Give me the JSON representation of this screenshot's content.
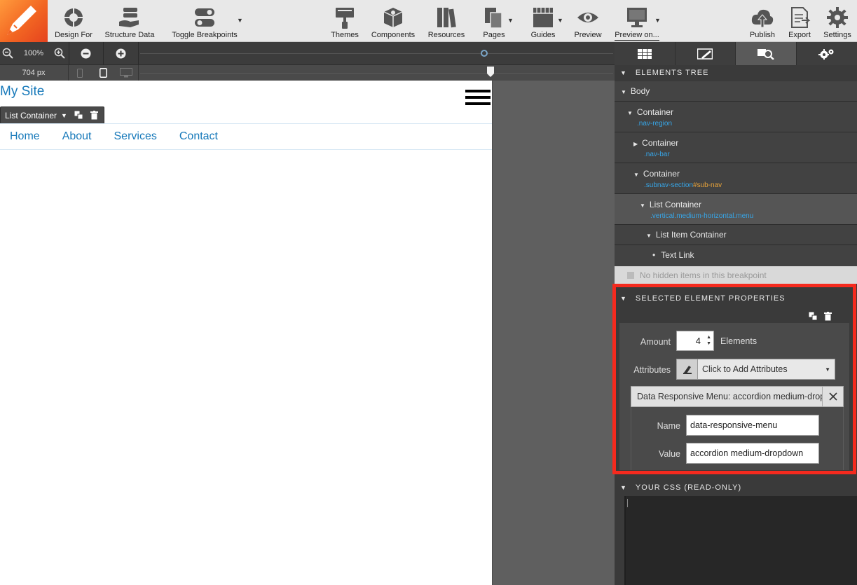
{
  "toolbar": {
    "tools_left": [
      {
        "label": "Design For",
        "icon": "target-icon"
      },
      {
        "label": "Structure Data",
        "icon": "stack-hand-icon"
      },
      {
        "label": "Toggle Breakpoints",
        "icon": "toggle-icon"
      }
    ],
    "tools_mid": [
      {
        "label": "Themes",
        "icon": "paint-roller-icon"
      },
      {
        "label": "Components",
        "icon": "cubes-icon"
      },
      {
        "label": "Resources",
        "icon": "books-icon"
      },
      {
        "label": "Pages",
        "icon": "pages-icon"
      },
      {
        "label": "Guides",
        "icon": "guides-icon"
      },
      {
        "label": "Preview",
        "icon": "eye-icon"
      },
      {
        "label": "Preview on...",
        "icon": "monitor-icon"
      }
    ],
    "tools_right": [
      {
        "label": "Publish",
        "icon": "cloud-upload-icon"
      },
      {
        "label": "Export",
        "icon": "export-icon"
      },
      {
        "label": "Settings",
        "icon": "gear-icon"
      }
    ]
  },
  "zoom": {
    "level": "100%",
    "slider_value": 0.727
  },
  "viewport": {
    "width_label": "704 px",
    "slider_value": 0.74
  },
  "canvas": {
    "site_title": "My Site",
    "selected_chip": "List Container",
    "nav_links": [
      "Home",
      "About",
      "Services",
      "Contact"
    ]
  },
  "elements_tree": {
    "header": "ELEMENTS TREE",
    "body_label": "Body",
    "rows": [
      {
        "name": "Container",
        "cls": ".nav-region",
        "id": ""
      },
      {
        "name": "Container",
        "cls": ".nav-bar",
        "id": ""
      },
      {
        "name": "Container",
        "cls": ".subnav-section",
        "id": "#sub-nav"
      },
      {
        "name": "List Container",
        "cls": ".vertical.medium-horizontal.menu",
        "id": ""
      },
      {
        "name": "List Item Container",
        "cls": "",
        "id": ""
      },
      {
        "name": "Text Link",
        "cls": "",
        "id": ""
      }
    ],
    "hidden_note": "No hidden items in this breakpoint"
  },
  "properties": {
    "header": "SELECTED ELEMENT PROPERTIES",
    "amount_label": "Amount",
    "amount_value": "4",
    "amount_unit": "Elements",
    "attributes_label": "Attributes",
    "attributes_placeholder": "Click to Add Attributes",
    "attribute_title": "Data Responsive Menu: accordion medium-dropdown",
    "name_label": "Name",
    "name_value": "data-responsive-menu",
    "value_label": "Value",
    "value_value": "accordion medium-dropdown"
  },
  "css": {
    "header": "YOUR CSS (READ-ONLY)"
  },
  "colors": {
    "accent": "#1779ba",
    "highlight": "#f52a1e",
    "logo": "#f26522"
  }
}
